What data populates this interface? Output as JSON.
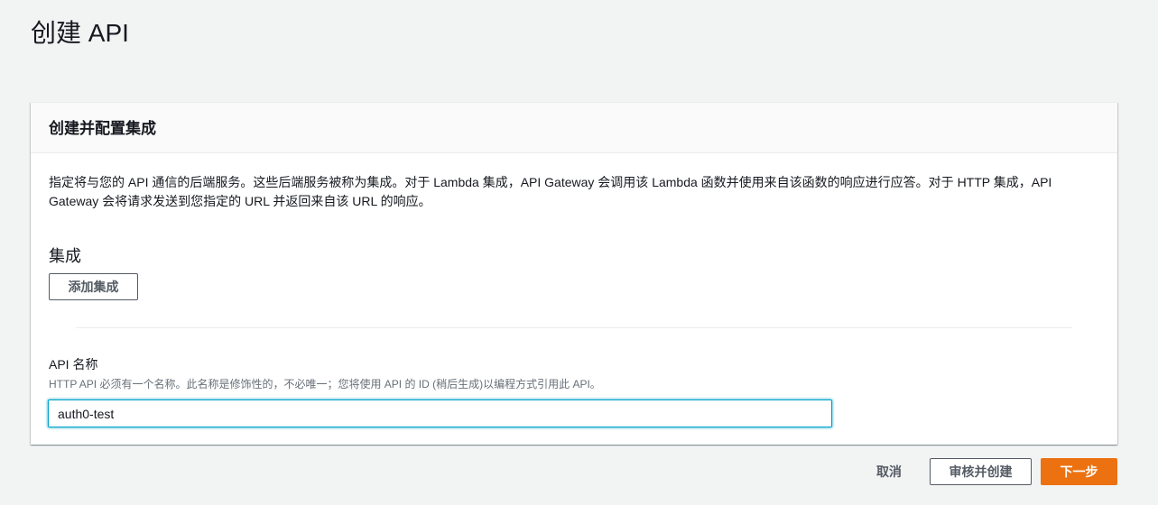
{
  "page": {
    "title": "创建 API"
  },
  "panel": {
    "title": "创建并配置集成",
    "description": "指定将与您的 API 通信的后端服务。这些后端服务被称为集成。对于 Lambda 集成，API Gateway 会调用该 Lambda 函数并使用来自该函数的响应进行应答。对于 HTTP 集成，API Gateway 会将请求发送到您指定的 URL 并返回来自该 URL 的响应。",
    "integrations": {
      "heading": "集成",
      "add_button_label": "添加集成"
    },
    "api_name": {
      "label": "API 名称",
      "hint": "HTTP API 必须有一个名称。此名称是修饰性的，不必唯一；您将使用 API 的 ID (稍后生成)以编程方式引用此 API。",
      "value": "auth0-test",
      "placeholder": ""
    }
  },
  "footer": {
    "cancel_label": "取消",
    "review_label": "审核并创建",
    "next_label": "下一步"
  },
  "colors": {
    "primary_button": "#ec7211",
    "focus_border": "#00a1c9",
    "page_background": "#f2f3f3"
  }
}
